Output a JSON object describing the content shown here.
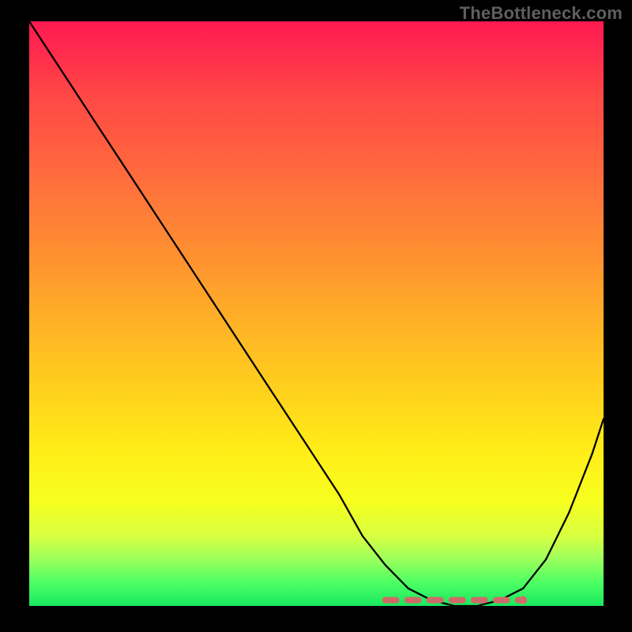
{
  "watermark": "TheBottleneck.com",
  "chart_data": {
    "type": "line",
    "title": "",
    "xlabel": "",
    "ylabel": "",
    "xlim": [
      0,
      100
    ],
    "ylim": [
      0,
      100
    ],
    "grid": false,
    "legend": false,
    "series": [
      {
        "name": "curve",
        "color": "#000000",
        "x": [
          0,
          6,
          12,
          18,
          24,
          30,
          36,
          42,
          48,
          54,
          58,
          62,
          66,
          70,
          74,
          78,
          82,
          86,
          90,
          94,
          98,
          100
        ],
        "values": [
          100,
          91,
          82,
          73,
          64,
          55,
          46,
          37,
          28,
          19,
          12,
          7,
          3,
          1,
          0,
          0,
          1,
          3,
          8,
          16,
          26,
          32
        ]
      }
    ],
    "highlight": {
      "name": "optimal-range",
      "style": "dashed",
      "color": "#d06a69",
      "x_range": [
        62,
        86
      ],
      "y_level": 1
    },
    "background_gradient": {
      "direction": "vertical",
      "stops": [
        {
          "pos": 0.0,
          "color": "#ff1a52"
        },
        {
          "pos": 0.5,
          "color": "#ffb326"
        },
        {
          "pos": 0.8,
          "color": "#f7ff1e"
        },
        {
          "pos": 1.0,
          "color": "#19e85f"
        }
      ]
    }
  }
}
